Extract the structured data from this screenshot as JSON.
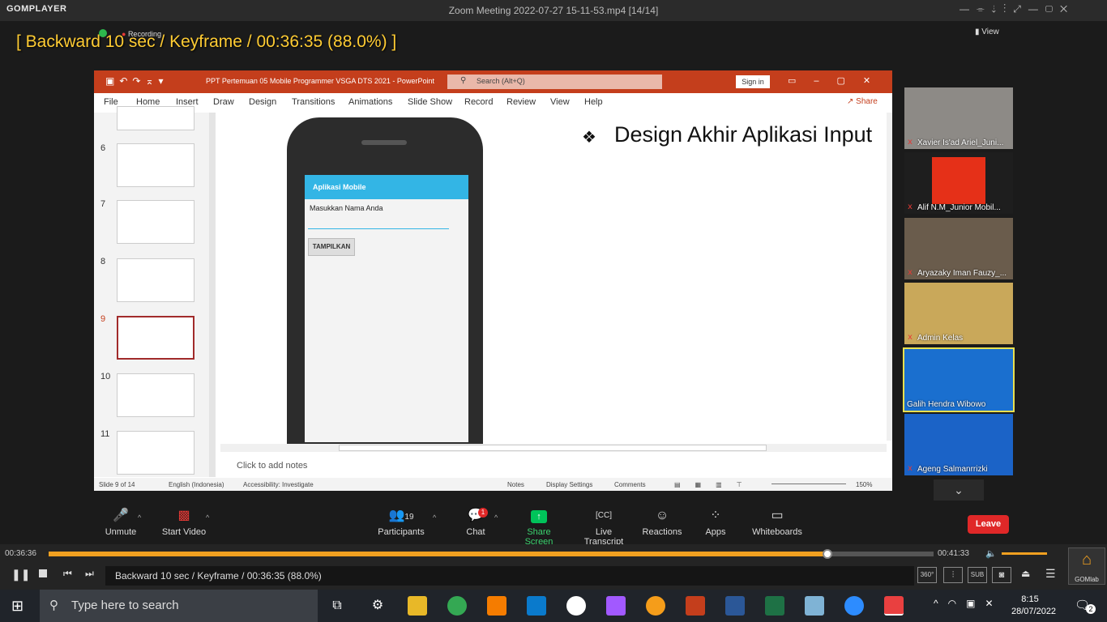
{
  "gom": {
    "logo": "GOMPLAYER",
    "title": "Zoom Meeting 2022-07-27 15-11-53.mp4  [14/14]",
    "osd": "[ Backward 10 sec / Keyframe / 00:36:35 (88.0%) ]",
    "recording": "Recording",
    "view": "View"
  },
  "ppt": {
    "filename": "PPT Pertemuan 05 Mobile Programmer VSGA DTS 2021  -  PowerPoint",
    "search_placeholder": "Search (Alt+Q)",
    "sign_in": "Sign in",
    "menu": [
      "File",
      "Home",
      "Insert",
      "Draw",
      "Design",
      "Transitions",
      "Animations",
      "Slide Show",
      "Record",
      "Review",
      "View",
      "Help"
    ],
    "share": "Share",
    "slide_numbers": [
      "6",
      "7",
      "8",
      "9",
      "10",
      "11"
    ],
    "selected_slide": "9",
    "slide_title": "Design Akhir Aplikasi Input",
    "bullet": "❖",
    "app": {
      "bar_title": "Aplikasi Mobile",
      "label": "Masukkan Nama Anda",
      "button": "TAMPILKAN"
    },
    "notes_placeholder": "Click to add notes",
    "status": {
      "slide": "Slide 9 of 14",
      "lang": "English (Indonesia)",
      "access": "Accessibility: Investigate",
      "notes": "Notes",
      "display": "Display Settings",
      "comments": "Comments",
      "zoom": "150%"
    }
  },
  "participants": [
    {
      "name": "Xavier Is'ad Ariel_Juni..."
    },
    {
      "name": "Alif N.M_Junior Mobil..."
    },
    {
      "name": "Aryazaky Iman Fauzy_..."
    },
    {
      "name": "Admin Kelas"
    },
    {
      "name": "Galih Hendra Wibowo"
    },
    {
      "name": "Ageng Salmanrrizki"
    }
  ],
  "zoom": {
    "unmute": "Unmute",
    "start_video": "Start Video",
    "participants": "Participants",
    "participants_count": "19",
    "chat": "Chat",
    "chat_badge": "1",
    "share": "Share Screen",
    "transcript": "Live Transcript",
    "reactions": "Reactions",
    "apps": "Apps",
    "whiteboards": "Whiteboards",
    "leave": "Leave"
  },
  "player": {
    "current": "00:36:36",
    "total": "00:41:33",
    "progress": 0.88,
    "status": "Backward 10 sec / Keyframe / 00:36:35 (88.0%)",
    "sub": "SUB",
    "brand": "GOMlab"
  },
  "taskbar": {
    "search": "Type here to search",
    "time": "8:15",
    "date": "28/07/2022",
    "notif": "2"
  },
  "colors": {
    "ppt_red": "#c43e1c",
    "share_green": "#00c35a",
    "leave_red": "#e02828",
    "app_blue": "#33b5e5",
    "osd_yellow": "#ffcc33",
    "seek_orange": "#f0a020"
  }
}
